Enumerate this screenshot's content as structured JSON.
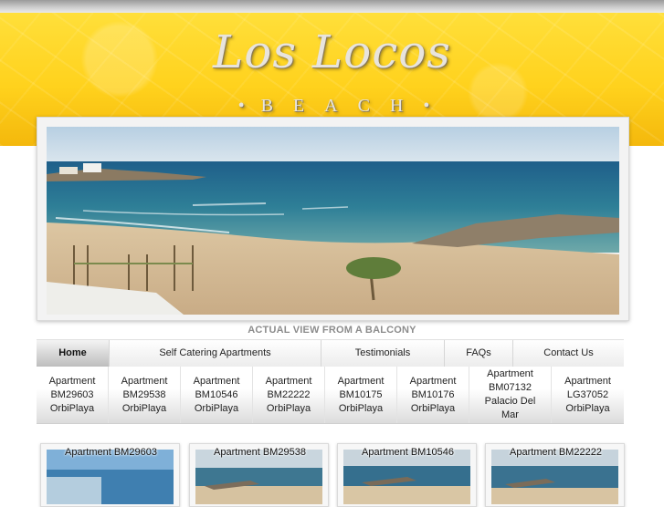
{
  "logo": {
    "title": "Los Locos",
    "subtitle": "BEACH",
    "dot_left": "•",
    "dot_right": "•"
  },
  "banner": {
    "caption": "ACTUAL VIEW FROM A BALCONY"
  },
  "nav": {
    "items": [
      {
        "label": "Home",
        "active": true
      },
      {
        "label": "Self Catering Apartments"
      },
      {
        "label": "Testimonials"
      },
      {
        "label": "FAQs"
      },
      {
        "label": "Contact Us"
      }
    ]
  },
  "apartments": [
    {
      "line1": "Apartment",
      "line2": "BM29603",
      "line3": "OrbiPlaya",
      "line4": ""
    },
    {
      "line1": "Apartment",
      "line2": "BM29538",
      "line3": "OrbiPlaya",
      "line4": ""
    },
    {
      "line1": "Apartment",
      "line2": "BM10546",
      "line3": "OrbiPlaya",
      "line4": ""
    },
    {
      "line1": "Apartment",
      "line2": "BM22222",
      "line3": "OrbiPlaya",
      "line4": ""
    },
    {
      "line1": "Apartment",
      "line2": "BM10175",
      "line3": "OrbiPlaya",
      "line4": ""
    },
    {
      "line1": "Apartment",
      "line2": "BM10176",
      "line3": "OrbiPlaya",
      "line4": ""
    },
    {
      "line1": "Apartment",
      "line2": "BM07132",
      "line3": "Palacio Del",
      "line4": "Mar"
    },
    {
      "line1": "Apartment",
      "line2": "LG37052",
      "line3": "OrbiPlaya",
      "line4": ""
    }
  ],
  "cards": [
    {
      "label": "Apartment BM29603"
    },
    {
      "label": "Apartment BM29538"
    },
    {
      "label": "Apartment BM10546"
    },
    {
      "label": "Apartment BM22222"
    }
  ],
  "colors": {
    "header_yellow": "#ffd21d",
    "header_orange": "#f4b80c",
    "caption_gray": "#8c8c8c"
  }
}
